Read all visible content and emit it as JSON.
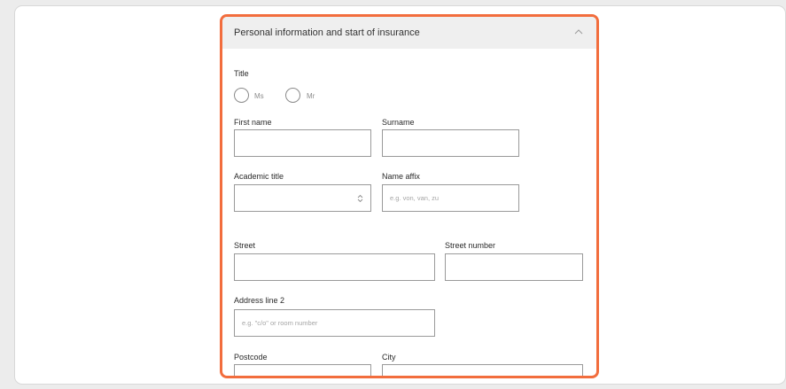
{
  "section": {
    "title": "Personal information and start of insurance",
    "collapse_icon": "chevron-up-icon"
  },
  "title_group": {
    "label": "Title",
    "options": [
      "Ms",
      "Mr"
    ]
  },
  "fields": {
    "first_name": {
      "label": "First name",
      "value": ""
    },
    "surname": {
      "label": "Surname",
      "value": ""
    },
    "academic_title": {
      "label": "Academic title",
      "value": "",
      "icon": "select-arrows-icon"
    },
    "name_affix": {
      "label": "Name affix",
      "placeholder": "e.g. von, van, zu"
    },
    "street": {
      "label": "Street",
      "value": ""
    },
    "street_number": {
      "label": "Street number",
      "value": ""
    },
    "address_line_2": {
      "label": "Address line 2",
      "placeholder": "e.g. \"c/o\" or room number"
    },
    "postcode": {
      "label": "Postcode",
      "value": ""
    },
    "city": {
      "label": "City",
      "value": ""
    }
  },
  "colors": {
    "highlight_border": "#f26d3d",
    "header_background": "#efefef"
  }
}
